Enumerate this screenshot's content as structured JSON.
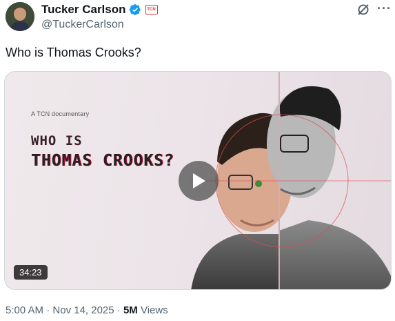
{
  "author": {
    "name": "Tucker Carlson",
    "handle": "@TuckerCarlson",
    "affiliation_badge": "TCN"
  },
  "tweet": {
    "text": "Who is Thomas Crooks?"
  },
  "media": {
    "kicker": "A TCN documentary",
    "title_line1": "WHO IS",
    "title_line2": "THOMAS CROOKS?",
    "duration": "34:23",
    "play_icon": "play-icon"
  },
  "meta": {
    "time": "5:00 AM",
    "separator": "·",
    "date": "Nov 14, 2025",
    "views_count": "5M",
    "views_label": "Views"
  },
  "icons": {
    "verified": "verified-badge-icon",
    "grok": "grok-icon",
    "more": "more-icon"
  },
  "colors": {
    "verified_blue": "#1d9bf0",
    "affiliation_red": "#d33333",
    "secondary_text": "#536471",
    "primary_text": "#0f1419"
  }
}
